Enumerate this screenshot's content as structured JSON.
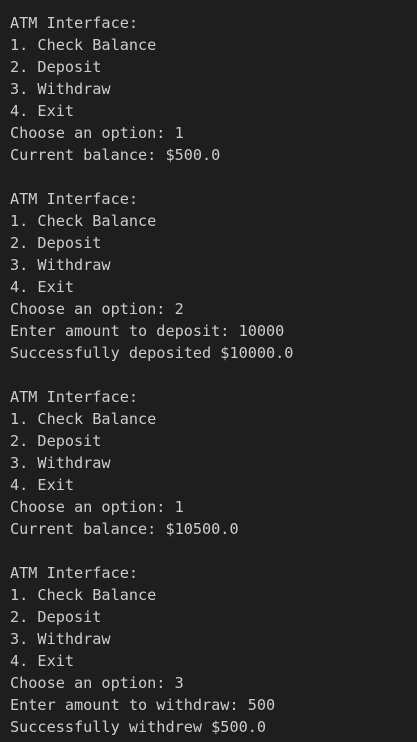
{
  "terminal": {
    "lines": [
      "ATM Interface:",
      "1. Check Balance",
      "2. Deposit",
      "3. Withdraw",
      "4. Exit",
      "Choose an option: 1",
      "Current balance: $500.0",
      "",
      "ATM Interface:",
      "1. Check Balance",
      "2. Deposit",
      "3. Withdraw",
      "4. Exit",
      "Choose an option: 2",
      "Enter amount to deposit: 10000",
      "Successfully deposited $10000.0",
      "",
      "ATM Interface:",
      "1. Check Balance",
      "2. Deposit",
      "3. Withdraw",
      "4. Exit",
      "Choose an option: 1",
      "Current balance: $10500.0",
      "",
      "ATM Interface:",
      "1. Check Balance",
      "2. Deposit",
      "3. Withdraw",
      "4. Exit",
      "Choose an option: 3",
      "Enter amount to withdraw: 500",
      "Successfully withdrew $500.0"
    ]
  },
  "colors": {
    "background": "#1e1e1e",
    "text": "#cccccc"
  }
}
